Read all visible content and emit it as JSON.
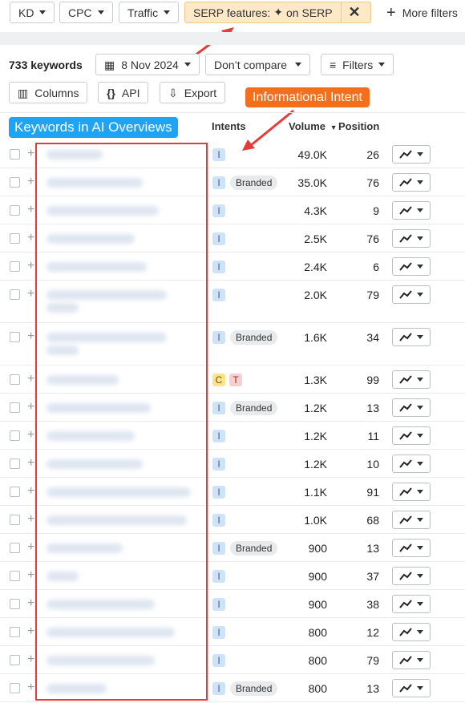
{
  "filters": {
    "kd": "KD",
    "cpc": "CPC",
    "traffic": "Traffic",
    "serp_prefix": "SERP features:",
    "serp_suffix": "on SERP",
    "more": "More filters"
  },
  "toolbar": {
    "count": "733 keywords",
    "date": "8 Nov 2024",
    "compare": "Don’t compare",
    "filters": "Filters",
    "columns": "Columns",
    "api": "API",
    "export": "Export"
  },
  "annotations": {
    "ai_overviews": "Keywords in AI Overviews",
    "informational": "Informational Intent",
    "accent_blue": "#1ea4f5",
    "accent_orange": "#f36f1c",
    "box_red": "#e53b3b"
  },
  "columns": {
    "intents": "Intents",
    "volume": "Volume",
    "position": "Position"
  },
  "rows": [
    {
      "intents": [
        "I"
      ],
      "branded": false,
      "volume": "49.0K",
      "position": "26"
    },
    {
      "intents": [
        "I"
      ],
      "branded": true,
      "volume": "35.0K",
      "position": "76"
    },
    {
      "intents": [
        "I"
      ],
      "branded": false,
      "volume": "4.3K",
      "position": "9"
    },
    {
      "intents": [
        "I"
      ],
      "branded": false,
      "volume": "2.5K",
      "position": "76"
    },
    {
      "intents": [
        "I"
      ],
      "branded": false,
      "volume": "2.4K",
      "position": "6"
    },
    {
      "intents": [
        "I"
      ],
      "branded": false,
      "volume": "2.0K",
      "position": "79"
    },
    {
      "intents": [
        "I"
      ],
      "branded": true,
      "volume": "1.6K",
      "position": "34"
    },
    {
      "intents": [
        "C",
        "T"
      ],
      "branded": false,
      "volume": "1.3K",
      "position": "99"
    },
    {
      "intents": [
        "I"
      ],
      "branded": true,
      "volume": "1.2K",
      "position": "13"
    },
    {
      "intents": [
        "I"
      ],
      "branded": false,
      "volume": "1.2K",
      "position": "11"
    },
    {
      "intents": [
        "I"
      ],
      "branded": false,
      "volume": "1.2K",
      "position": "10"
    },
    {
      "intents": [
        "I"
      ],
      "branded": false,
      "volume": "1.1K",
      "position": "91"
    },
    {
      "intents": [
        "I"
      ],
      "branded": false,
      "volume": "1.0K",
      "position": "68"
    },
    {
      "intents": [
        "I"
      ],
      "branded": true,
      "volume": "900",
      "position": "13"
    },
    {
      "intents": [
        "I"
      ],
      "branded": false,
      "volume": "900",
      "position": "37"
    },
    {
      "intents": [
        "I"
      ],
      "branded": false,
      "volume": "900",
      "position": "38"
    },
    {
      "intents": [
        "I"
      ],
      "branded": false,
      "volume": "800",
      "position": "12"
    },
    {
      "intents": [
        "I"
      ],
      "branded": false,
      "volume": "800",
      "position": "79"
    },
    {
      "intents": [
        "I"
      ],
      "branded": true,
      "volume": "800",
      "position": "13"
    }
  ],
  "branded_label": "Branded"
}
